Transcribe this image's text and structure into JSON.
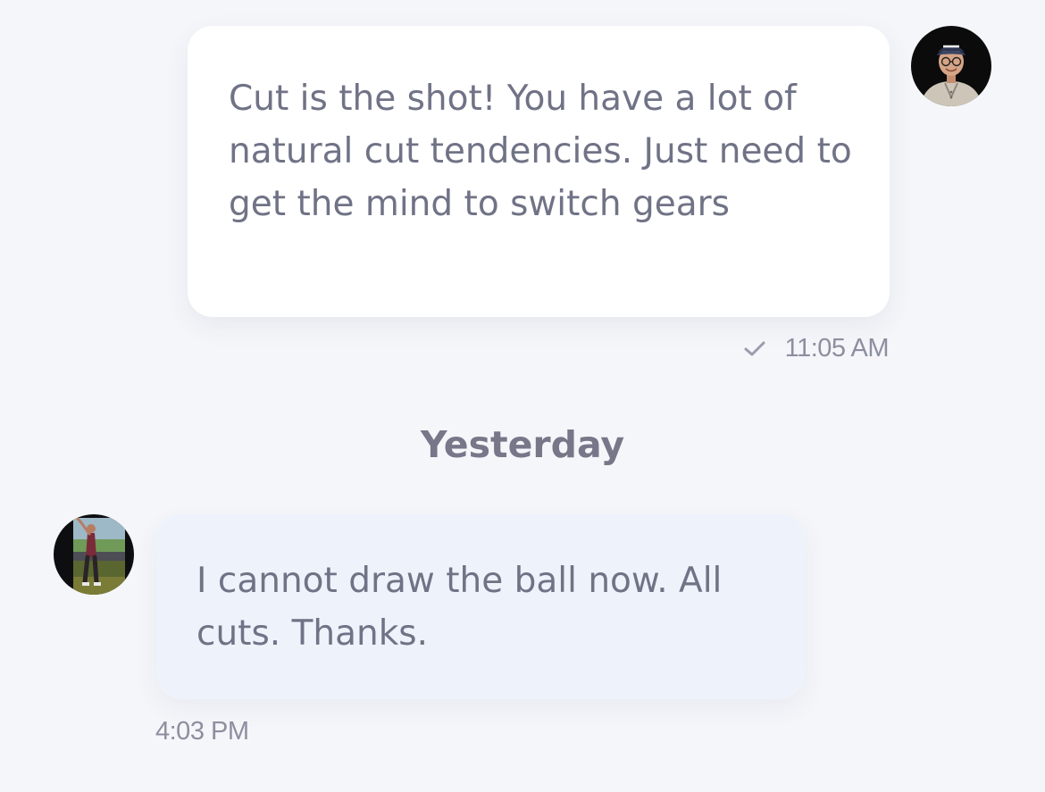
{
  "messages": [
    {
      "direction": "outgoing",
      "text": "Cut is the shot!  You have a lot of natural cut tendencies.  Just need to get the mind to switch gears",
      "time": "11:05 AM",
      "status_icon": "check-icon",
      "avatar": "coach-avatar"
    },
    {
      "direction": "incoming",
      "text": "I cannot draw the ball now. All cuts. Thanks.",
      "time": "4:03 PM",
      "avatar": "student-avatar"
    }
  ],
  "date_divider": "Yesterday",
  "colors": {
    "background": "#f5f6fa",
    "outgoing_bubble": "#ffffff",
    "incoming_bubble": "#eef3fb",
    "message_text": "#707386",
    "meta_text": "#8c8f9f"
  }
}
